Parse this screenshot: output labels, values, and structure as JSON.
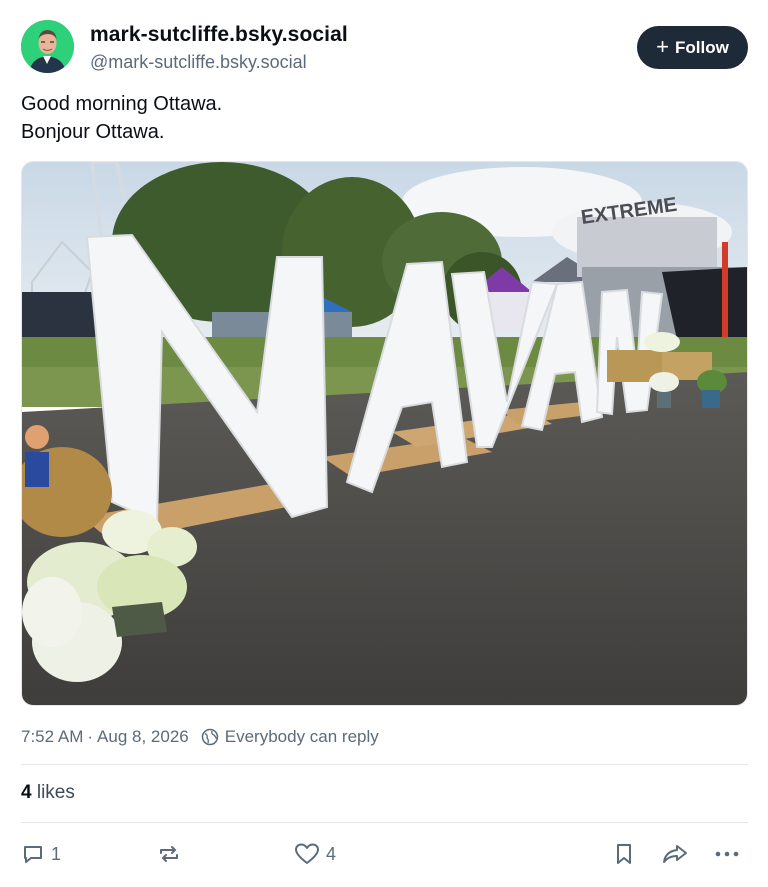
{
  "author": {
    "display_name": "mark-sutcliffe.bsky.social",
    "handle": "@mark-sutcliffe.bsky.social",
    "avatar_bg": "#2fd07a"
  },
  "follow_button": {
    "label": "Follow",
    "icon": "plus-icon",
    "bg": "#1e2a38"
  },
  "post": {
    "lines": [
      "Good morning Ottawa.",
      "Bonjour Ottawa."
    ]
  },
  "image": {
    "sign_text": "NAVAN",
    "stage_sign": "EXTREME"
  },
  "meta": {
    "time": "7:52 AM",
    "separator": "·",
    "date": "Aug 8, 2026",
    "reply_setting": "Everybody can reply",
    "reply_icon": "globe-icon"
  },
  "stats": {
    "likes_count": "4",
    "likes_label": "likes"
  },
  "actions": {
    "reply_count": "1",
    "repost_count": "",
    "like_count": "4",
    "icons": [
      "reply-icon",
      "repost-icon",
      "like-icon",
      "bookmark-icon",
      "share-icon",
      "more-icon"
    ]
  },
  "colors": {
    "text": "#0b0f14",
    "muted": "#5b6b7b",
    "divider": "#e4e8ec"
  }
}
